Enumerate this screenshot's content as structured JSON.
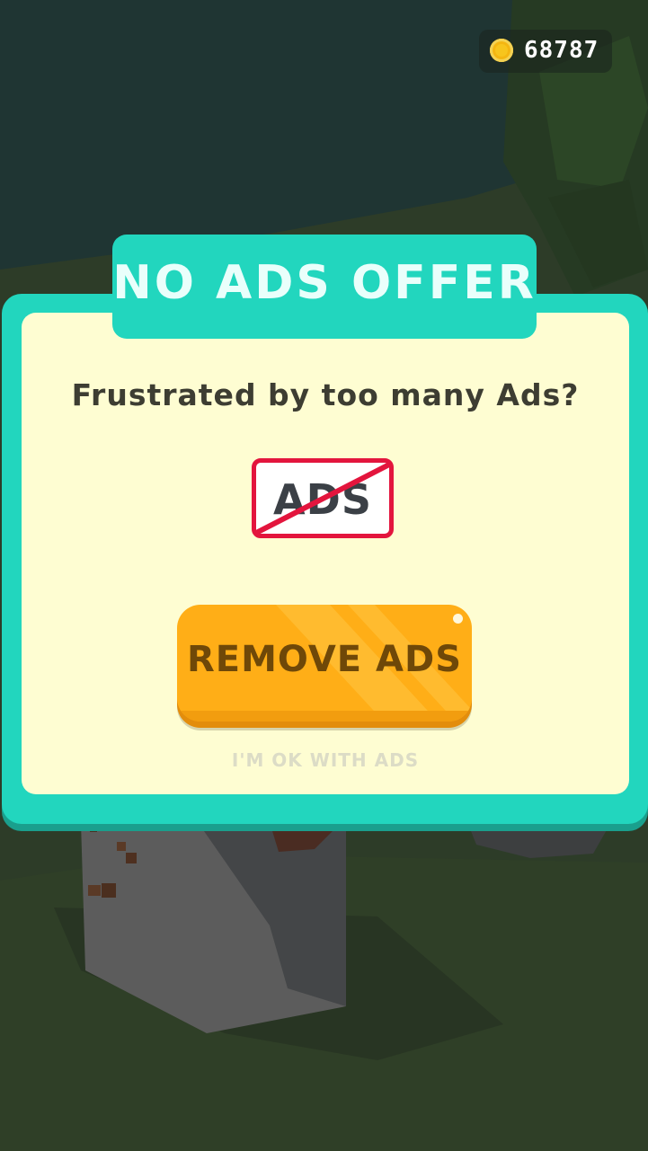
{
  "hud": {
    "coin_icon": "coin-icon",
    "coins": "68787"
  },
  "dialog": {
    "title": "NO ADS OFFER",
    "question": "Frustrated by too many Ads?",
    "badge_text": "ADS",
    "remove_button_label": "REMOVE ADS",
    "decline_link": "I'M OK WITH ADS"
  },
  "colors": {
    "frame": "#22d6be",
    "panel": "#fefdd2",
    "button": "#ffae17",
    "button_text": "#6f4808",
    "badge_border": "#e3153d"
  }
}
